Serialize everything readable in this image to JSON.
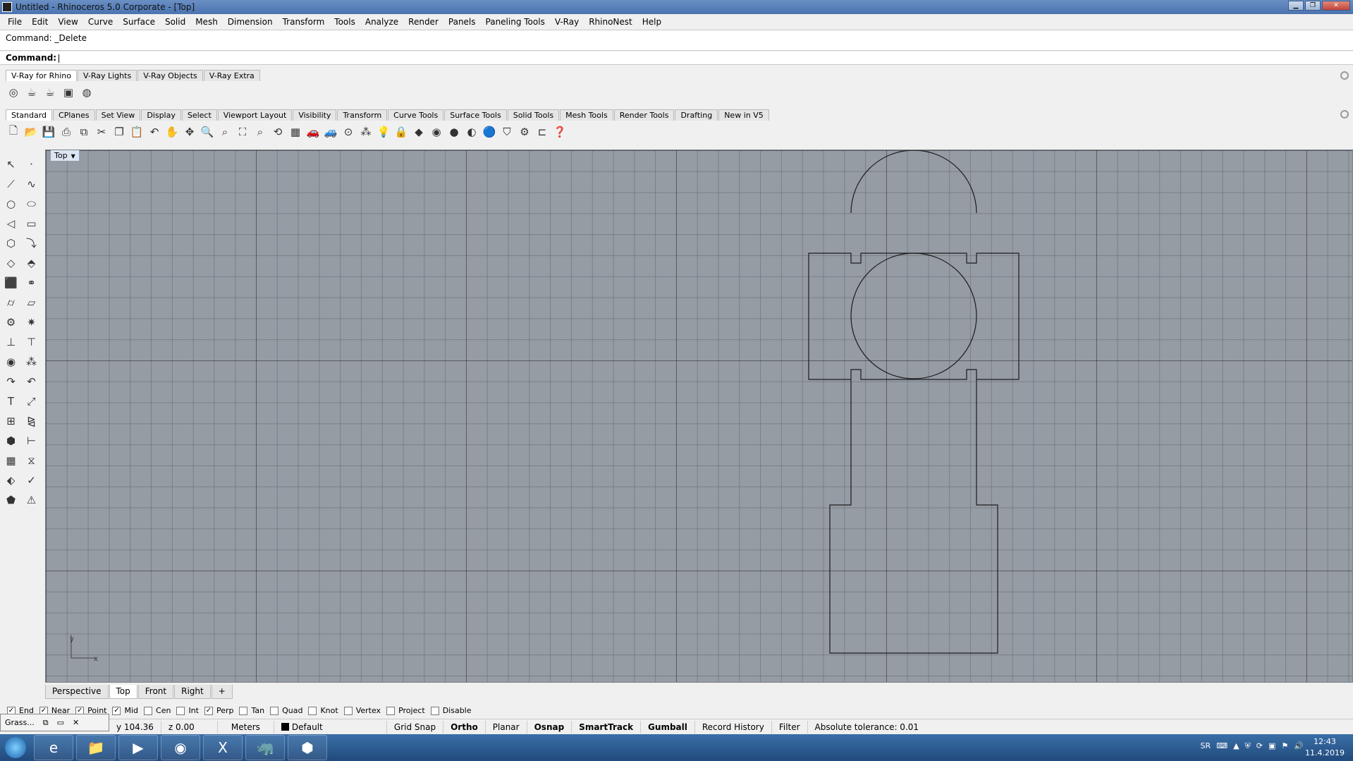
{
  "window": {
    "title": "Untitled - Rhinoceros  5.0 Corporate - [Top]"
  },
  "menu": [
    "File",
    "Edit",
    "View",
    "Curve",
    "Surface",
    "Solid",
    "Mesh",
    "Dimension",
    "Transform",
    "Tools",
    "Analyze",
    "Render",
    "Panels",
    "Paneling Tools",
    "V-Ray",
    "RhinoNest",
    "Help"
  ],
  "command": {
    "history": "Command: _Delete",
    "prompt": "Command:"
  },
  "vray_tabs": [
    "V-Ray for Rhino",
    "V-Ray Lights",
    "V-Ray Objects",
    "V-Ray Extra"
  ],
  "main_tabs": [
    "Standard",
    "CPlanes",
    "Set View",
    "Display",
    "Select",
    "Viewport Layout",
    "Visibility",
    "Transform",
    "Curve Tools",
    "Surface Tools",
    "Solid Tools",
    "Mesh Tools",
    "Render Tools",
    "Drafting",
    "New in V5"
  ],
  "viewport": {
    "name": "Top",
    "axis_y": "y",
    "axis_x": "x"
  },
  "view_tabs": [
    "Perspective",
    "Top",
    "Front",
    "Right",
    "+"
  ],
  "osnaps": [
    {
      "label": "End",
      "checked": true
    },
    {
      "label": "Near",
      "checked": true
    },
    {
      "label": "Point",
      "checked": true
    },
    {
      "label": "Mid",
      "checked": true
    },
    {
      "label": "Cen",
      "checked": false
    },
    {
      "label": "Int",
      "checked": false
    },
    {
      "label": "Perp",
      "checked": true
    },
    {
      "label": "Tan",
      "checked": false
    },
    {
      "label": "Quad",
      "checked": false
    },
    {
      "label": "Knot",
      "checked": false
    },
    {
      "label": "Vertex",
      "checked": false
    },
    {
      "label": "Project",
      "checked": false
    },
    {
      "label": "Disable",
      "checked": false
    }
  ],
  "grasshopper_panel": {
    "label": "Grass..."
  },
  "status": {
    "y": "y 104.36",
    "z": "z 0.00",
    "units": "Meters",
    "layer": "Default",
    "grid_snap": "Grid Snap",
    "ortho": "Ortho",
    "planar": "Planar",
    "osnap": "Osnap",
    "smarttrack": "SmartTrack",
    "gumball": "Gumball",
    "record_history": "Record History",
    "filter": "Filter",
    "tolerance": "Absolute tolerance: 0.01"
  },
  "tray": {
    "lang": "SR",
    "time": "12:43",
    "date": "11.4.2019"
  }
}
